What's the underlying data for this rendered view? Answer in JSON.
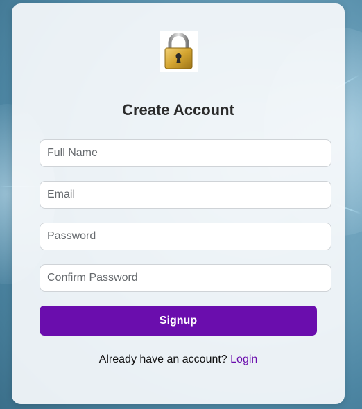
{
  "signup_form": {
    "title": "Create Account",
    "lock_icon": "lock-icon",
    "fields": {
      "full_name_placeholder": "Full Name",
      "email_placeholder": "Email",
      "password_placeholder": "Password",
      "confirm_password_placeholder": "Confirm Password"
    },
    "signup_label": "Signup",
    "footer_text": "Already have an account?",
    "login_link": "Login"
  },
  "colors": {
    "accent": "#6a0dad",
    "card_background": "#f6f9fb"
  }
}
